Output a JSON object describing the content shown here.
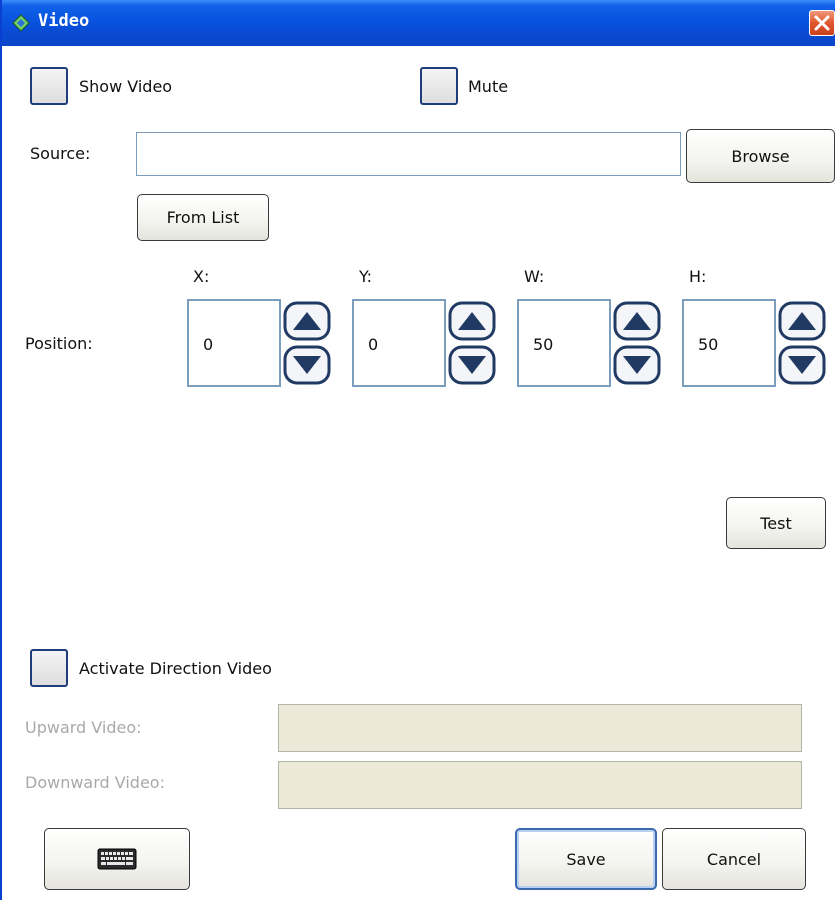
{
  "window": {
    "title": "Video",
    "icon": "app-icon",
    "close_icon": "close-icon"
  },
  "options": {
    "show_video_label": "Show Video",
    "mute_label": "Mute",
    "activate_direction_label": "Activate Direction Video"
  },
  "source": {
    "label": "Source:",
    "value": "",
    "browse_label": "Browse",
    "from_list_label": "From List"
  },
  "position": {
    "label": "Position:",
    "fields": [
      {
        "label": "X:",
        "value": "0"
      },
      {
        "label": "Y:",
        "value": "0"
      },
      {
        "label": "W:",
        "value": "50"
      },
      {
        "label": "H:",
        "value": "50"
      }
    ]
  },
  "test_label": "Test",
  "direction": {
    "upward_label": "Upward Video:",
    "upward_value": "",
    "downward_label": "Downward Video:",
    "downward_value": ""
  },
  "footer": {
    "keyboard_icon": "keyboard-icon",
    "save_label": "Save",
    "cancel_label": "Cancel"
  },
  "colors": {
    "titlebar": "#0853df",
    "border_accent": "#1d3e7a",
    "disabled_text": "#a9a9a9",
    "disabled_field": "#ece9d8"
  }
}
